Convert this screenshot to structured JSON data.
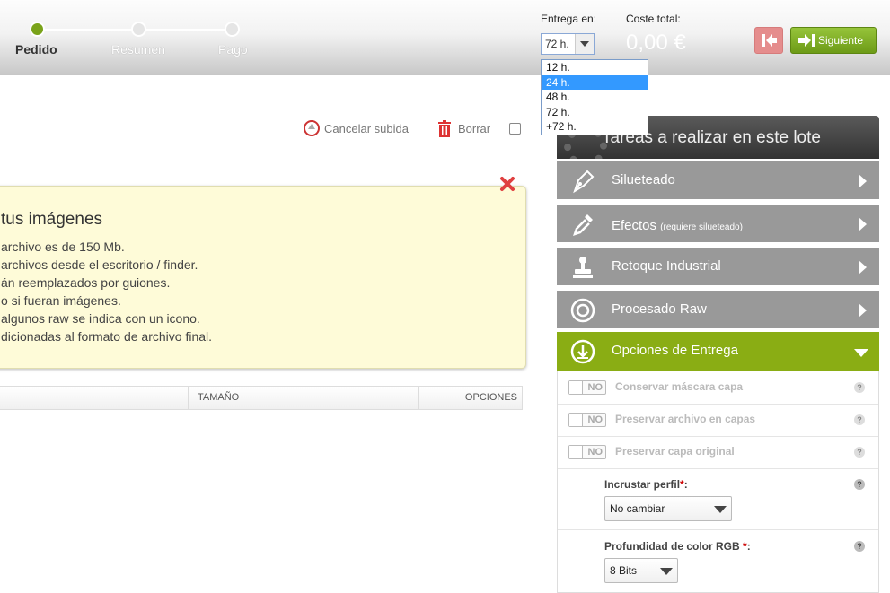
{
  "steps": [
    {
      "label": "Pedido",
      "active": true
    },
    {
      "label": "Resumen",
      "active": false
    },
    {
      "label": "Pago",
      "active": false
    }
  ],
  "delivery": {
    "label": "Entrega en:",
    "selected": "72 h.",
    "options": [
      "12 h.",
      "24 h.",
      "48 h.",
      "72 h.",
      "+72 h."
    ],
    "highlighted": "24 h."
  },
  "total": {
    "label": "Coste total:",
    "value": "0,00 €"
  },
  "nav": {
    "next_label": "Siguiente"
  },
  "toolbar": {
    "cancel_label": "Cancelar subida",
    "delete_label": "Borrar"
  },
  "info": {
    "title": "tus imágenes",
    "lines": [
      "archivo es de 150 Mb.",
      "archivos desde el escritorio / finder.",
      "án reemplazados por guiones.",
      "o si fueran imágenes.",
      " algunos raw se indica con un icono.",
      "dicionadas al formato de archivo final."
    ]
  },
  "table": {
    "col_size": "TAMAÑO",
    "col_options": "OPCIONES"
  },
  "panel": {
    "title": "Tareas a realizar en este lote",
    "sections": [
      {
        "label": "Silueteado",
        "note": ""
      },
      {
        "label": "Efectos",
        "note": "(requiere silueteado)"
      },
      {
        "label": "Retoque Industrial",
        "note": ""
      },
      {
        "label": "Procesado Raw",
        "note": ""
      },
      {
        "label": "Opciones de Entrega",
        "note": ""
      }
    ],
    "options": [
      {
        "toggle": "NO",
        "label": "Conservar máscara capa"
      },
      {
        "toggle": "NO",
        "label": "Preservar archivo en capas"
      },
      {
        "toggle": "NO",
        "label": "Preservar capa original"
      }
    ],
    "profile": {
      "label": "Incrustar perfil",
      "value": "No cambiar"
    },
    "depth": {
      "label": "Profundidad de color RGB",
      "value": "8 Bits"
    },
    "required_mark": "*",
    "help": "?"
  },
  "colors": {
    "accent_green": "#8aad14",
    "section_gray": "#999999",
    "danger_red": "#cc3333"
  }
}
